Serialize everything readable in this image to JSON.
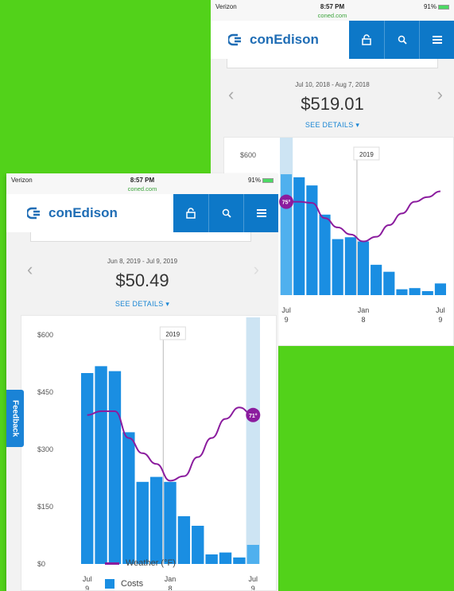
{
  "back": {
    "status": {
      "carrier": "Verizon",
      "time": "8:57 PM",
      "battery": "91%",
      "url": "coned.com"
    },
    "brand": "conEdison",
    "period": "Jul 10, 2018 - Aug 7, 2018",
    "amount": "$519.01",
    "details": "SEE DETAILS",
    "year_tag": "2019",
    "highlight_temp": "75°"
  },
  "front": {
    "status": {
      "carrier": "Verizon",
      "time": "8:57 PM",
      "battery": "91%",
      "url": "coned.com"
    },
    "brand": "conEdison",
    "period": "Jun 8, 2019 - Jul 9, 2019",
    "amount": "$50.49",
    "details": "SEE DETAILS",
    "year_tag": "2019",
    "highlight_temp": "71°",
    "feedback": "Feedback",
    "legend": {
      "weather": "Weather (°F)",
      "costs": "Costs"
    }
  },
  "colors": {
    "background": "#52d21a",
    "brand_blue": "#1f6db5",
    "nav_blue": "#0d78c8",
    "bar": "#1a8ee2",
    "weather_line": "#8b1c9e"
  },
  "icons": {
    "lock": "lock-icon",
    "search": "search-icon",
    "menu": "menu-icon",
    "wifi": "wifi-icon",
    "chevron": "chevron-icon"
  },
  "chart_data": [
    {
      "type": "bar",
      "series": [
        {
          "name": "Costs",
          "values": [
            500,
            518,
            505,
            345,
            215,
            228,
            215,
            125,
            100,
            25,
            30,
            17,
            50
          ]
        },
        {
          "name": "Weather (°F)",
          "values": [
            390,
            400,
            400,
            330,
            290,
            262,
            218,
            230,
            280,
            330,
            380,
            410,
            390
          ]
        }
      ],
      "ticks_x": [
        {
          "i": 0,
          "m": "Jul",
          "d": "9"
        },
        {
          "i": 6,
          "m": "Jan",
          "d": "8"
        },
        {
          "i": 12,
          "m": "Jul",
          "d": "9"
        }
      ],
      "y_ticks": [
        "$600",
        "$450",
        "$300",
        "$150",
        "$0"
      ],
      "ylim": [
        0,
        600
      ],
      "highlight_index": 12
    },
    {
      "type": "bar",
      "series": [
        {
          "name": "Costs",
          "values": [
            518,
            505,
            470,
            345,
            240,
            248,
            230,
            130,
            100,
            25,
            30,
            17,
            50
          ]
        },
        {
          "name": "Weather (°F)",
          "values": [
            400,
            400,
            395,
            330,
            290,
            260,
            230,
            250,
            300,
            350,
            400,
            420,
            445
          ]
        }
      ],
      "ticks_x": [
        {
          "i": 0,
          "m": "Jul",
          "d": "9"
        },
        {
          "i": 6,
          "m": "Jan",
          "d": "8"
        },
        {
          "i": 12,
          "m": "Jul",
          "d": "9"
        }
      ],
      "y_ticks": [
        "$600"
      ],
      "ylim": [
        0,
        600
      ],
      "highlight_index": 0
    }
  ]
}
